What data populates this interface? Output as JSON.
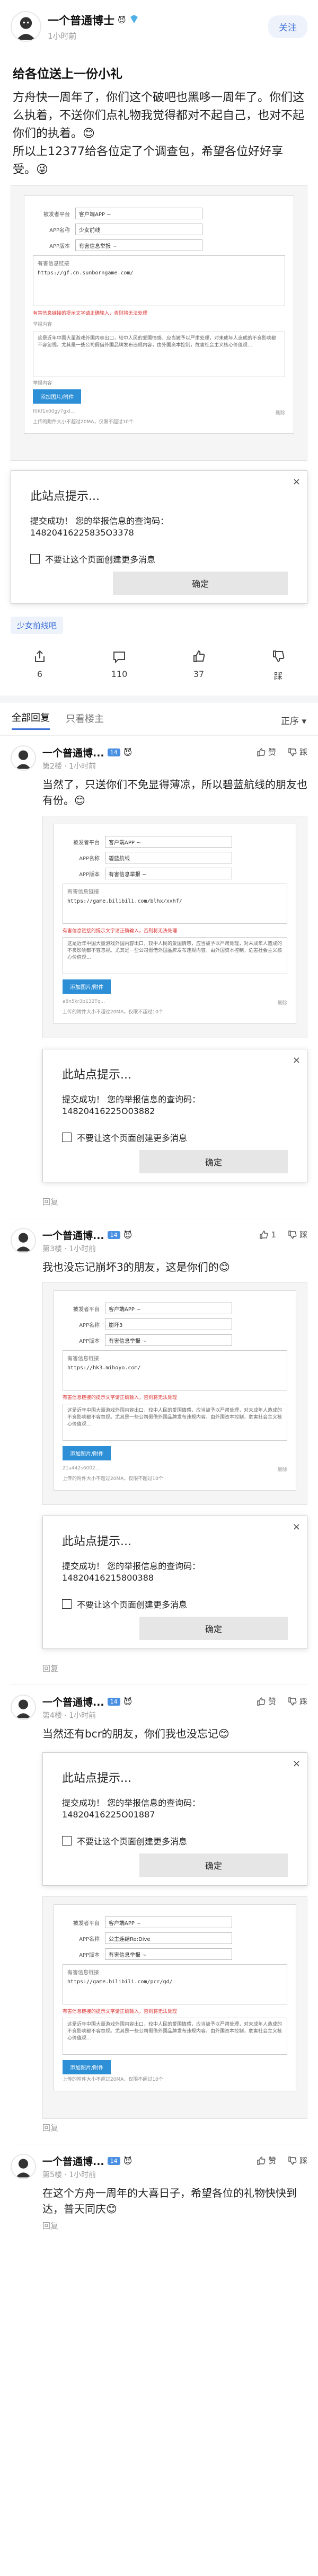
{
  "post": {
    "author": "一个普通博士",
    "author_badge": "😈",
    "time": "1小时前",
    "follow_label": "关注",
    "title": "给各位送上一份小礼",
    "body": "方舟快一周年了，你们这个破吧也黑哆一周年了。你们这么执着，不送你们点礼物我觉得都对不起自己，也对不起你们的执着。😊\n所以上12377给各位定了个调查包，希望各位好好享受。😜"
  },
  "form_mock": {
    "label_server": "被发者平台",
    "label_app": "APP名称",
    "label_appid": "APP版本",
    "value_server": "客户端APP ~",
    "value_app": "少女前线",
    "value_version": "有害信息举报 ~",
    "label_link": "有害信息链接",
    "link_url": "https://gf.cn.sunborngame.com/",
    "red_note": "有害信息链接的提示文字请正确输入，否则将无法处理",
    "label_desc": "举报内容",
    "desc_text": "这是近年中国大量游戏外国内容出口，较中人民的爱国情感，应当被予以严肃处理，对未成年人造成的不良影响都不容忽视。尤其是一些公司假借外国品牌发布违规内容，由外国资本控制，危害社会主义核心价值观...",
    "upload_label": "添加图片/附件",
    "file_hint": "上传的附件大小不超过20MA，仅限不超过10个",
    "file_name_1": "f0Kf1x00gy7gxl...",
    "file_state": "删除"
  },
  "dialog_main": {
    "title": "此站点提示...",
    "line1": "提交成功！ 您的举报信息的查询码：",
    "code": "14820416225835O3378",
    "checkbox_label": "不要让这个页面创建更多消息",
    "ok_label": "确定",
    "close": "×"
  },
  "tag": "少女前线吧",
  "post_actions": {
    "share_count": "6",
    "comment_count": "110",
    "like_count": "37",
    "dislike_label": "踩"
  },
  "tabs": {
    "all": "全部回复",
    "only_author": "只看楼主",
    "sort": "正序 ▾"
  },
  "comments": [
    {
      "name": "一个普通博...",
      "badge": "😈",
      "level": "14",
      "floor_time": "第2楼 · 1小时前",
      "text": "当然了，只送你们不免显得薄凉，所以碧蓝航线的朋友也有份。😊",
      "like": "赞",
      "dislike": "踩",
      "form": {
        "value_app": "碧蓝航线",
        "link_url": "https://game.bilibili.com/blhx/xxhf/",
        "file_name_1": "a8n5kr3b132Tq...",
        "file_state": "删除"
      },
      "dialog": {
        "title": "此站点提示...",
        "line1": "提交成功！ 您的举报信息的查询码：",
        "code": "14820416225O03882",
        "checkbox_label": "不要让这个页面创建更多消息",
        "ok_label": "确定"
      },
      "reply": "回复"
    },
    {
      "name": "一个普通博...",
      "badge": "😈",
      "level": "14",
      "floor_time": "第3楼 · 1小时前",
      "text": "我也没忘记崩坏3的朋友，这是你们的😊",
      "like": "1",
      "dislike": "踩",
      "form": {
        "value_app": "崩坏3",
        "link_url": "https://hk3.mihoyo.com/",
        "file_name_1": "21a442s6002...",
        "file_state": "删除"
      },
      "dialog": {
        "title": "此站点提示...",
        "line1": "提交成功！ 您的举报信息的查询码：",
        "code": "14820416215800388",
        "checkbox_label": "不要让这个页面创建更多消息",
        "ok_label": "确定"
      },
      "reply": "回复"
    },
    {
      "name": "一个普通博...",
      "badge": "😈",
      "level": "14",
      "floor_time": "第4楼 · 1小时前",
      "text": "当然还有bcr的朋友，你们我也没忘记😊",
      "like": "赞",
      "dislike": "踩",
      "form": {
        "value_app": "公主连结Re:Dive",
        "link_url": "https://game.bilibili.com/pcr/gd/",
        "file_name_1": "",
        "file_state": ""
      },
      "dialog": {
        "title": "此站点提示...",
        "line1": "提交成功！ 您的举报信息的查询码：",
        "code": "14820416225O01887",
        "checkbox_label": "不要让这个页面创建更多消息",
        "ok_label": "确定"
      },
      "reply": "回复"
    },
    {
      "name": "一个普通博...",
      "badge": "😈",
      "level": "14",
      "floor_time": "第5楼 · 1小时前",
      "text": "在这个方舟一周年的大喜日子，希望各位的礼物快快到达，普天同庆😊",
      "like": "赞",
      "dislike": "踩",
      "reply": "回复"
    }
  ],
  "colors": {
    "accent": "#3b6fd8",
    "badge_blue": "#4a90e2",
    "muted": "#999999"
  }
}
